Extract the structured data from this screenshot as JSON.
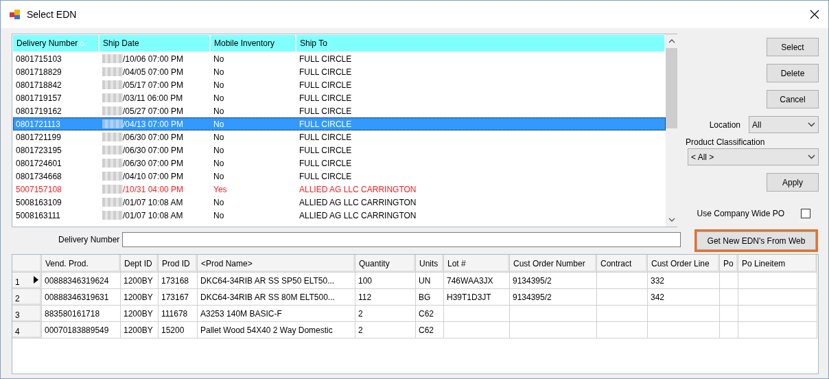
{
  "window": {
    "title": "Select EDN"
  },
  "edn_list": {
    "columns": [
      {
        "label": "Delivery Number",
        "sorted": true
      },
      {
        "label": "Ship Date",
        "sorted": false
      },
      {
        "label": "Mobile Inventory",
        "sorted": false
      },
      {
        "label": "Ship To",
        "sorted": false
      }
    ],
    "rows": [
      {
        "cells": [
          "0801715103",
          "/10/06 07:00 PM",
          "No",
          "FULL CIRCLE"
        ],
        "selected": false,
        "alert": false
      },
      {
        "cells": [
          "0801718829",
          "/04/05 07:00 PM",
          "No",
          "FULL CIRCLE"
        ],
        "selected": false,
        "alert": false
      },
      {
        "cells": [
          "0801718842",
          "/05/17 07:00 PM",
          "No",
          "FULL CIRCLE"
        ],
        "selected": false,
        "alert": false
      },
      {
        "cells": [
          "0801719157",
          "/03/11 06:00 PM",
          "No",
          "FULL CIRCLE"
        ],
        "selected": false,
        "alert": false
      },
      {
        "cells": [
          "0801719162",
          "/05/27 07:00 PM",
          "No",
          "FULL CIRCLE"
        ],
        "selected": false,
        "alert": false
      },
      {
        "cells": [
          "0801721113",
          "/04/13 07:00 PM",
          "No",
          "FULL CIRCLE"
        ],
        "selected": true,
        "alert": false
      },
      {
        "cells": [
          "0801721199",
          "/06/30 07:00 PM",
          "No",
          "FULL CIRCLE"
        ],
        "selected": false,
        "alert": false
      },
      {
        "cells": [
          "0801723195",
          "/06/30 07:00 PM",
          "No",
          "FULL CIRCLE"
        ],
        "selected": false,
        "alert": false
      },
      {
        "cells": [
          "0801724601",
          "/06/30 07:00 PM",
          "No",
          "FULL CIRCLE"
        ],
        "selected": false,
        "alert": false
      },
      {
        "cells": [
          "0801734668",
          "/04/10 07:00 PM",
          "No",
          "FULL CIRCLE"
        ],
        "selected": false,
        "alert": false
      },
      {
        "cells": [
          "5007157108",
          "/10/31 04:00 PM",
          "Yes",
          "ALLIED AG LLC CARRINGTON"
        ],
        "selected": false,
        "alert": true
      },
      {
        "cells": [
          "5008163109",
          "/01/07 10:08 AM",
          "No",
          "ALLIED AG LLC CARRINGTON"
        ],
        "selected": false,
        "alert": false
      },
      {
        "cells": [
          "5008163111",
          "/01/07 10:08 AM",
          "No",
          "ALLIED AG LLC CARRINGTON"
        ],
        "selected": false,
        "alert": false
      }
    ]
  },
  "buttons": [
    {
      "label": "Select",
      "focused": false
    },
    {
      "label": "Delete",
      "focused": false
    },
    {
      "label": "Cancel",
      "focused": false
    }
  ],
  "location": {
    "label": "Location",
    "value": "All"
  },
  "product_classification": {
    "label": "Product Classification",
    "value": "< All >"
  },
  "apply_button": {
    "label": "Apply",
    "focused": false
  },
  "company_wide_po": {
    "label": "Use Company Wide PO",
    "checked": false
  },
  "web_button": {
    "label": "Get New EDN's From Web",
    "focused": true
  },
  "delivery_number": {
    "label": "Delivery Number"
  },
  "products": {
    "columns": [
      "Vend. Prod.",
      "Dept ID",
      "Prod ID",
      "<Prod Name>",
      "Quantity",
      "Units",
      "Lot #",
      "Cust Order Number",
      "Contract",
      "Cust Order Line",
      "Po",
      "Po Lineitem"
    ],
    "rows": [
      {
        "number": "1",
        "current": true,
        "cells": [
          "00888346319624",
          "1200BY",
          "173168",
          "DKC64-34RIB AR SS SP50 ELT50...",
          "100",
          "UN",
          "746WAA3JX",
          "9134395/2",
          "",
          "332",
          "",
          ""
        ]
      },
      {
        "number": "2",
        "current": false,
        "cells": [
          "00888346319631",
          "1200BY",
          "173167",
          "DKC64-34RIB AR SS 80M ELT500...",
          "112",
          "BG",
          "H39T1D3JT",
          "9134395/2",
          "",
          "342",
          "",
          ""
        ]
      },
      {
        "number": "3",
        "current": false,
        "cells": [
          "883580161718",
          "1200BY",
          "111678",
          "A3253 140M BASIC-F",
          "2",
          "C62",
          "",
          "",
          "",
          "",
          "",
          ""
        ]
      },
      {
        "number": "4",
        "current": false,
        "cells": [
          "00070183889549",
          "1200BY",
          "15200",
          "Pallet Wood 54X40 2 Way Domestic",
          "2",
          "C62",
          "",
          "",
          "",
          "",
          "",
          ""
        ]
      }
    ]
  }
}
